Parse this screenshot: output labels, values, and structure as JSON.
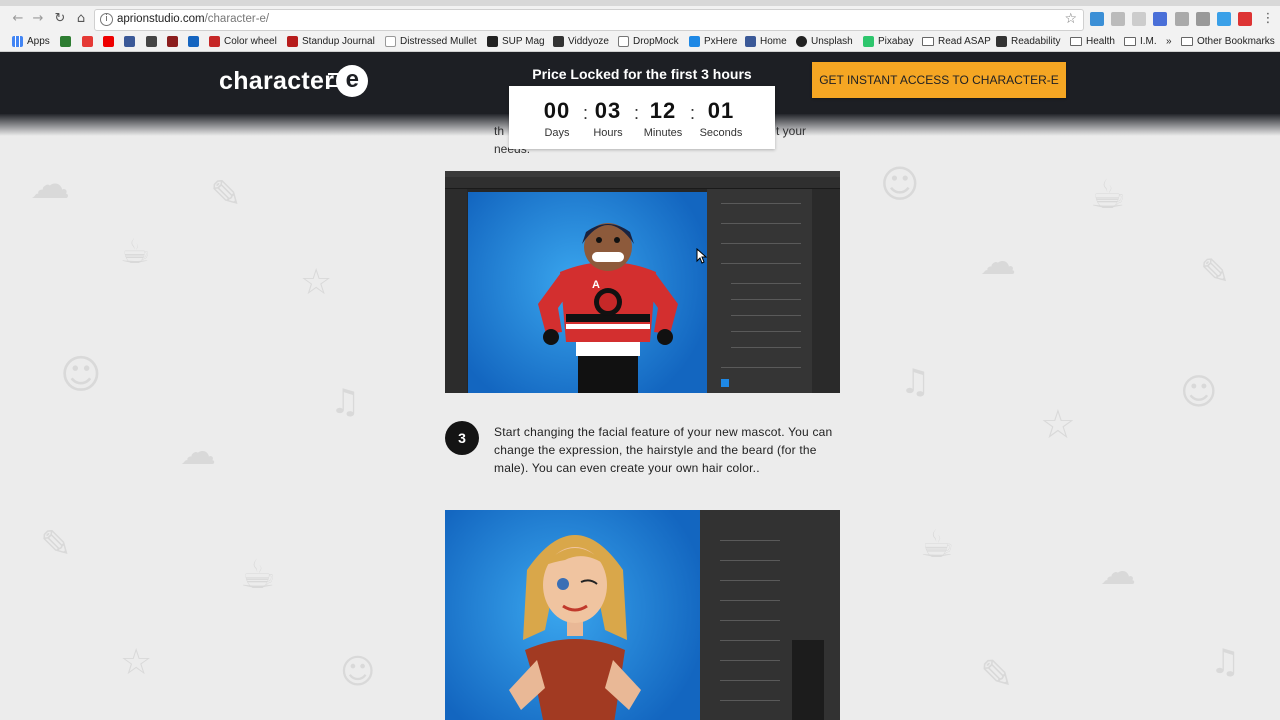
{
  "browser": {
    "url_host": "aprionstudio.com",
    "url_path": "/character-e/",
    "bookmarks": [
      "Apps",
      "Color wheel",
      "Standup Journal",
      "Distressed Mullet",
      "SUP Mag",
      "Viddyoze",
      "DropMock",
      "PxHere",
      "Home",
      "Unsplash",
      "Pixabay",
      "Read ASAP",
      "Readability",
      "Health",
      "I.M.",
      "»",
      "Other Bookmarks"
    ]
  },
  "header": {
    "logo_text": "character",
    "logo_badge": "e",
    "price_title": "Price Locked for the first 3 hours",
    "countdown": [
      {
        "value": "00",
        "label": "Days"
      },
      {
        "value": "03",
        "label": "Hours"
      },
      {
        "value": "12",
        "label": "Minutes"
      },
      {
        "value": "01",
        "label": "Seconds"
      }
    ],
    "cta_label": "GET INSTANT ACCESS TO CHARACTER-E"
  },
  "content": {
    "partial_text_left": "th",
    "partial_text_right": "t your",
    "partial_text_line2": "needs.",
    "step3_number": "3",
    "step3_text": "Start changing the facial feature of your new mascot. You can change the expression, the hairstyle and the beard (for the male). You can even create your own hair color..",
    "jersey_letter": "A"
  },
  "colors": {
    "header_bg": "#1d1f24",
    "accent": "#f5a623",
    "canvas_blue": "#1e88e5"
  }
}
